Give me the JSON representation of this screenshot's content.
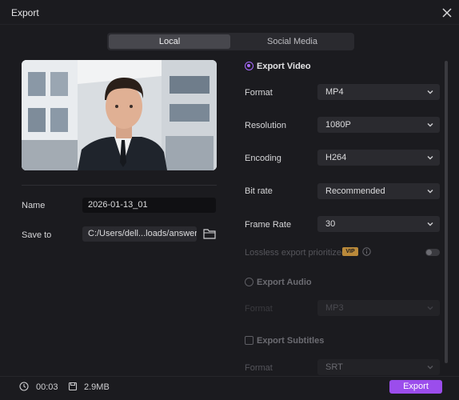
{
  "window": {
    "title": "Export"
  },
  "tabs": {
    "local": "Local",
    "social": "Social Media"
  },
  "left": {
    "name_label": "Name",
    "name_value": "2026-01-13_01",
    "save_label": "Save to",
    "save_value": "C:/Users/dell...loads/answers"
  },
  "video": {
    "title": "Export Video",
    "format_label": "Format",
    "format_value": "MP4",
    "resolution_label": "Resolution",
    "resolution_value": "1080P",
    "encoding_label": "Encoding",
    "encoding_value": "H264",
    "bitrate_label": "Bit rate",
    "bitrate_value": "Recommended",
    "framerate_label": "Frame Rate",
    "framerate_value": "30",
    "lossless_label": "Lossless export prioritized",
    "vip_badge": "VIP"
  },
  "audio": {
    "title": "Export Audio",
    "format_label": "Format",
    "format_value": "MP3"
  },
  "subtitles": {
    "title": "Export Subtitles",
    "format_label": "Format",
    "format_value": "SRT"
  },
  "footer": {
    "duration": "00:03",
    "size": "2.9MB",
    "export_label": "Export"
  },
  "colors": {
    "accent": "#9b4dec",
    "radio_on": "#a86bff",
    "vip": "#b9893a"
  }
}
